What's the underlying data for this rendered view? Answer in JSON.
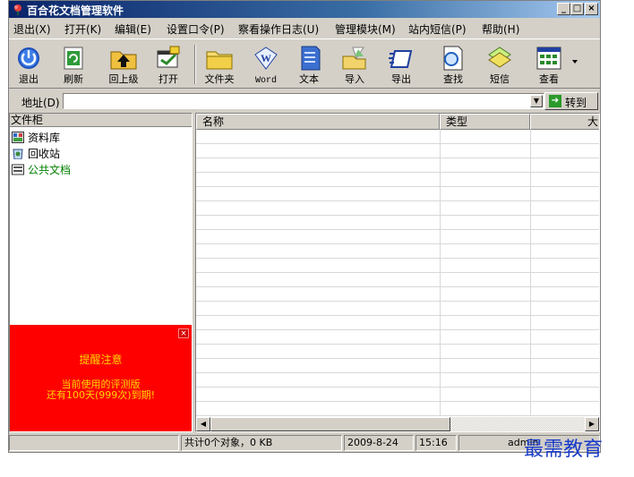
{
  "window": {
    "title": "百合花文档管理软件"
  },
  "title_buttons": {
    "minimize": "_",
    "maximize": "□",
    "close": "×"
  },
  "menu": [
    {
      "label": "退出(X)"
    },
    {
      "label": "打开(K)"
    },
    {
      "label": "编辑(E)"
    },
    {
      "label": "设置口令(P)"
    },
    {
      "label": "察看操作日志(U)"
    },
    {
      "label": "管理模块(M)"
    },
    {
      "label": "站内短信(P)"
    },
    {
      "label": "帮助(H)"
    }
  ],
  "toolbar": {
    "exit": "退出",
    "refresh": "刷新",
    "up": "回上级",
    "open": "打开",
    "folder": "文件夹",
    "word": "Word",
    "text": "文本",
    "import": "导入",
    "export": "导出",
    "search": "查找",
    "sms": "短信",
    "view": "查看",
    "word_icon_text": "W"
  },
  "address": {
    "label": "地址(D)",
    "value": "",
    "go": "转到"
  },
  "left": {
    "header": "文件柜",
    "items": [
      {
        "label": "资料库",
        "color": "#000000"
      },
      {
        "label": "回收站",
        "color": "#000000"
      },
      {
        "label": "公共文档",
        "color": "#008000"
      }
    ],
    "notice": {
      "title": "提醒注意",
      "line1": "当前使用的评测版",
      "line2": "还有100天(999次)到期!",
      "close": "×"
    }
  },
  "table": {
    "columns": [
      "名称",
      "类型",
      "大"
    ]
  },
  "status": {
    "left": "",
    "summary": "共计0个对象，0 KB",
    "date": "2009-8-24",
    "time": "15:16",
    "user": "admin"
  },
  "watermark": "最需教育",
  "colors": {
    "accent_title": "#0a246a",
    "notice_bg": "#ff0000",
    "notice_text": "#ffd700",
    "watermark": "#1a3cc8"
  }
}
